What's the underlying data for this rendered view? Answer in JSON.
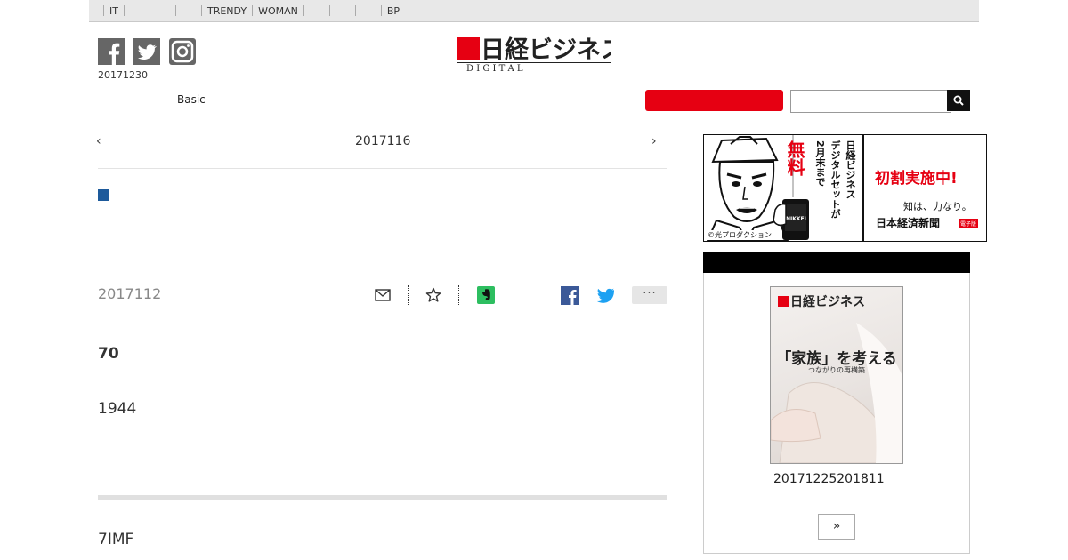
{
  "top_nav": {
    "items": [
      "IT",
      "",
      "",
      "",
      "TRENDY",
      "WOMAN",
      "",
      "",
      "",
      "BP"
    ]
  },
  "header": {
    "date": "20171230",
    "logo": {
      "main": "日経ビジネス",
      "sub": "D I G I T A L"
    },
    "social_icons": [
      "facebook-icon",
      "twitter-icon",
      "instagram-icon"
    ]
  },
  "subnav": {
    "basic_label": "Basic",
    "search_placeholder": ""
  },
  "article": {
    "pager_prev": "‹",
    "pager_title": "2017116",
    "pager_next": "›",
    "pub_date": "2017112",
    "lead": "70",
    "paragraph1": "1944",
    "paragraph2": "7IMF",
    "more_label": "···"
  },
  "ad": {
    "vertical_text_1": "日経ビジネス",
    "vertical_text_2": "デジタルセットが",
    "vertical_text_3": "2月末まで",
    "free_label": "無料",
    "headline": "初割実施中!",
    "tagline": "知は、力なり。",
    "brand": "日本経済新聞",
    "badge": "電子版",
    "credit": "©光プロダクション",
    "phone_label": "NIKKEI"
  },
  "magazine": {
    "cover_logo": "日経ビジネス",
    "cover_headline": "「家族」を考える",
    "cover_sub": "つながりの再構築",
    "issue_date": "20171225201811",
    "more_label": "»"
  },
  "colors": {
    "brand_red": "#e60012",
    "accent_blue": "#1d5a9b",
    "facebook_blue": "#3b5998",
    "twitter_blue": "#1da1f2",
    "evernote_green": "#2dbe60",
    "social_grey": "#666666"
  }
}
